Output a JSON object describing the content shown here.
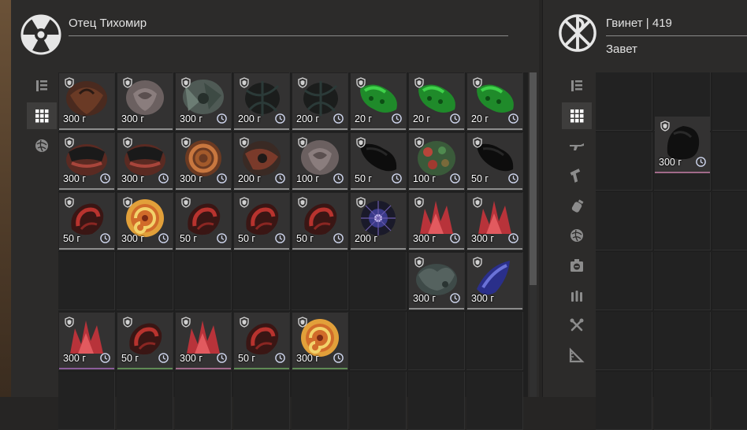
{
  "left_trader": {
    "name": "Отец Тихомир",
    "logo": "radiation-icon"
  },
  "right_trader": {
    "name": "Гвинет | 419",
    "subtitle": "Завет",
    "logo": "chi-rho-icon"
  },
  "left_tabs": [
    {
      "icon": "sort-icon",
      "active": false
    },
    {
      "icon": "grid-icon",
      "active": true
    },
    {
      "icon": "artifact-icon",
      "active": false
    }
  ],
  "right_tabs": [
    {
      "icon": "sort-icon",
      "active": false
    },
    {
      "icon": "grid-icon",
      "active": true
    },
    {
      "icon": "rifle-icon",
      "active": false
    },
    {
      "icon": "pistol-icon",
      "active": false
    },
    {
      "icon": "grenade-icon",
      "active": false
    },
    {
      "icon": "artifact-icon",
      "active": false
    },
    {
      "icon": "medkit-icon",
      "active": false
    },
    {
      "icon": "ammo-icon",
      "active": false
    },
    {
      "icon": "tools-icon",
      "active": false
    },
    {
      "icon": "ruler-icon",
      "active": false
    }
  ],
  "left_items": [
    {
      "price": "300 г",
      "clock": false,
      "art": "flower-dark"
    },
    {
      "price": "300 г",
      "clock": false,
      "art": "rose-grey"
    },
    {
      "price": "300 г",
      "clock": true,
      "art": "crystal-green-grey"
    },
    {
      "price": "200 г",
      "clock": true,
      "art": "thorns-dark"
    },
    {
      "price": "200 г",
      "clock": true,
      "art": "thorns-dark"
    },
    {
      "price": "20 г",
      "clock": true,
      "art": "green-blob"
    },
    {
      "price": "20 г",
      "clock": true,
      "art": "green-blob"
    },
    {
      "price": "20 г",
      "clock": true,
      "art": "green-blob"
    },
    {
      "price": "300 г",
      "clock": true,
      "art": "rock-red"
    },
    {
      "price": "300 г",
      "clock": true,
      "art": "rock-red"
    },
    {
      "price": "300 г",
      "clock": true,
      "art": "coil"
    },
    {
      "price": "200 г",
      "clock": true,
      "art": "orb-rust"
    },
    {
      "price": "100 г",
      "clock": true,
      "art": "rose-grey"
    },
    {
      "price": "50 г",
      "clock": true,
      "art": "black-blob"
    },
    {
      "price": "100 г",
      "clock": true,
      "art": "mosaic"
    },
    {
      "price": "50 г",
      "clock": true,
      "art": "black-blob"
    },
    {
      "price": "50 г",
      "clock": true,
      "art": "shell-red"
    },
    {
      "price": "300 г",
      "clock": true,
      "art": "swirl-orange"
    },
    {
      "price": "50 г",
      "clock": true,
      "art": "shell-red"
    },
    {
      "price": "50 г",
      "clock": true,
      "art": "shell-red"
    },
    {
      "price": "50 г",
      "clock": true,
      "art": "shell-red"
    },
    {
      "price": "200 г",
      "clock": false,
      "art": "star-blue"
    },
    {
      "price": "300 г",
      "clock": true,
      "art": "crystal-red"
    },
    {
      "price": "300 г",
      "clock": true,
      "art": "crystal-red"
    },
    {
      "price": "300 г",
      "clock": true,
      "art": "moss-grey"
    },
    {
      "price": "300 г",
      "clock": false,
      "art": "shard-blue"
    },
    {
      "price": "300 г",
      "clock": true,
      "art": "crystal-red",
      "edge": "purple"
    },
    {
      "price": "50 г",
      "clock": true,
      "art": "shell-red",
      "edge": "green"
    },
    {
      "price": "300 г",
      "clock": true,
      "art": "crystal-red",
      "edge": "pink"
    },
    {
      "price": "50 г",
      "clock": true,
      "art": "shell-red",
      "edge": "green"
    },
    {
      "price": "300 г",
      "clock": true,
      "art": "swirl-orange",
      "edge": "green"
    }
  ],
  "right_items": [
    {
      "price": "300 г",
      "clock": true,
      "art": "black-rock",
      "edge": "pink"
    }
  ],
  "colors": {
    "panel": "#2c2b2a",
    "cell": "#222222",
    "item_bg": "#333232",
    "accent_green": "#2fae2f",
    "accent_red": "#b33a35"
  }
}
